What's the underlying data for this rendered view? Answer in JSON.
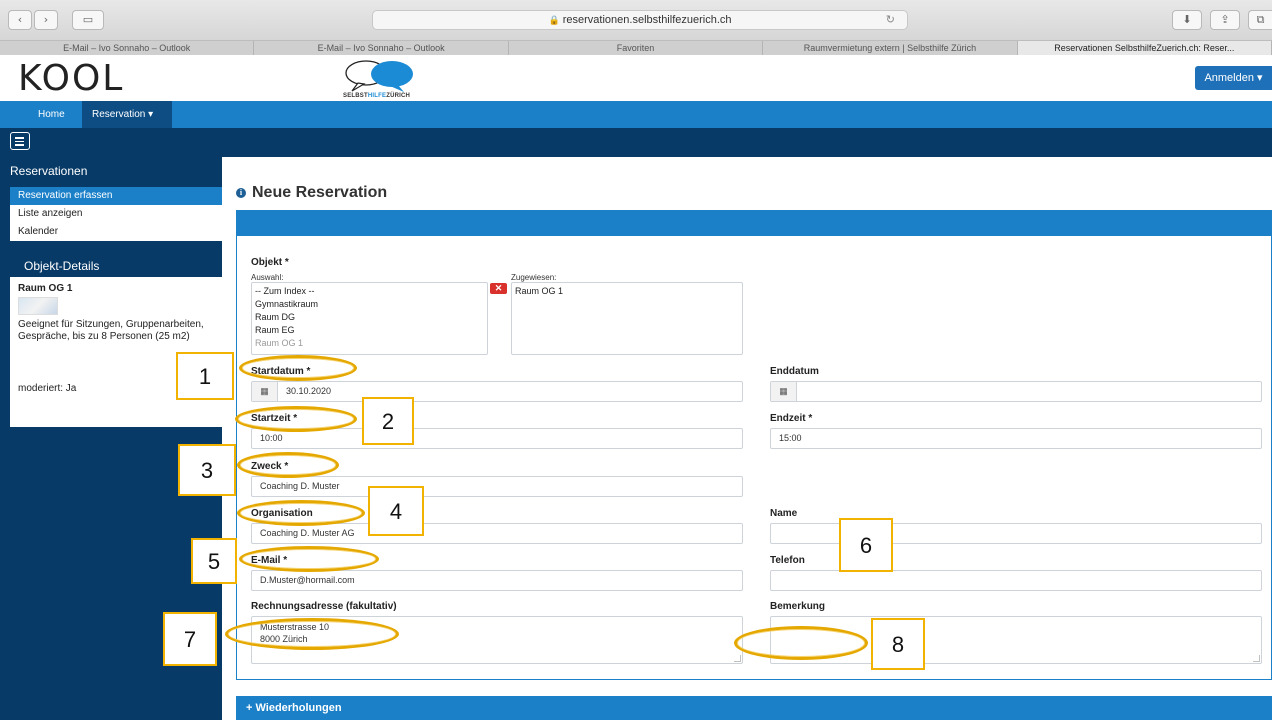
{
  "browser": {
    "url": "reservationen.selbsthilfezuerich.ch",
    "lock_glyph": "🔒",
    "reload_glyph": "↻",
    "back_glyph": "‹",
    "forward_glyph": "›",
    "sidebar_glyph": "▭",
    "download_glyph": "⬇",
    "share_glyph": "⇪",
    "tabs_glyph": "⧉",
    "tabs": [
      {
        "label": "E-Mail – Ivo Sonnaho – Outlook"
      },
      {
        "label": "E-Mail – Ivo Sonnaho – Outlook"
      },
      {
        "label": "Favoriten"
      },
      {
        "label": "Raumvermietung extern | Selbsthilfe Zürich"
      },
      {
        "label": "Reservationen SelbsthilfeZuerich.ch: Reser..."
      }
    ]
  },
  "header": {
    "logo_text": "KOOL",
    "brand_text_1": "SELBST",
    "brand_text_2": "HILFE",
    "brand_text_3": "ZÜRICH",
    "login_label": "Anmelden ▾"
  },
  "nav": {
    "home": "Home",
    "reservation": "Reservation ▾"
  },
  "sidebar": {
    "reservations_title": "Reservationen",
    "items": [
      {
        "label": "Reservation erfassen",
        "active": true
      },
      {
        "label": "Liste anzeigen",
        "active": false
      },
      {
        "label": "Kalender",
        "active": false
      }
    ],
    "details_title": "Objekt-Details",
    "room_name": "Raum OG 1",
    "room_desc": "Geeignet für Sitzungen, Gruppenarbeiten, Gespräche, bis zu 8 Personen (25 m2)",
    "moderated": "moderiert: Ja"
  },
  "form": {
    "title": "Neue Reservation",
    "info_glyph": "i",
    "objekt_label": "Objekt *",
    "auswahl_label": "Auswahl:",
    "zugewiesen_label": "Zugewiesen:",
    "auswahl_options": [
      "-- Zum Index --",
      "Gymnastikraum",
      "Raum DG",
      "Raum EG",
      "Raum OG 1"
    ],
    "zugewiesen_options": [
      "Raum OG 1"
    ],
    "remove_glyph": "✕",
    "calendar_glyph": "▦",
    "startdatum_label": "Startdatum *",
    "startdatum_value": "30.10.2020",
    "enddatum_label": "Enddatum",
    "enddatum_value": "",
    "startzeit_label": "Startzeit *",
    "startzeit_value": "10:00",
    "endzeit_label": "Endzeit *",
    "endzeit_value": "15:00",
    "zweck_label": "Zweck *",
    "zweck_value": "Coaching D. Muster",
    "organisation_label": "Organisation",
    "organisation_value": "Coaching D. Muster AG",
    "name_label": "Name",
    "name_value": "",
    "email_label": "E-Mail *",
    "email_value": "D.Muster@hormail.com",
    "telefon_label": "Telefon",
    "telefon_value": "",
    "rechnung_label": "Rechnungsadresse (fakultativ)",
    "rechnung_line1": "Musterstrasse 10",
    "rechnung_line2": "8000 Zürich",
    "bemerkung_label": "Bemerkung",
    "bemerkung_value": "",
    "wiederholungen_label": "+ Wiederholungen"
  },
  "annotations": {
    "colors": {
      "ring": "#e5a800",
      "box": "#f2b300"
    },
    "numbers": [
      "1",
      "2",
      "3",
      "4",
      "5",
      "6",
      "7",
      "8"
    ]
  }
}
